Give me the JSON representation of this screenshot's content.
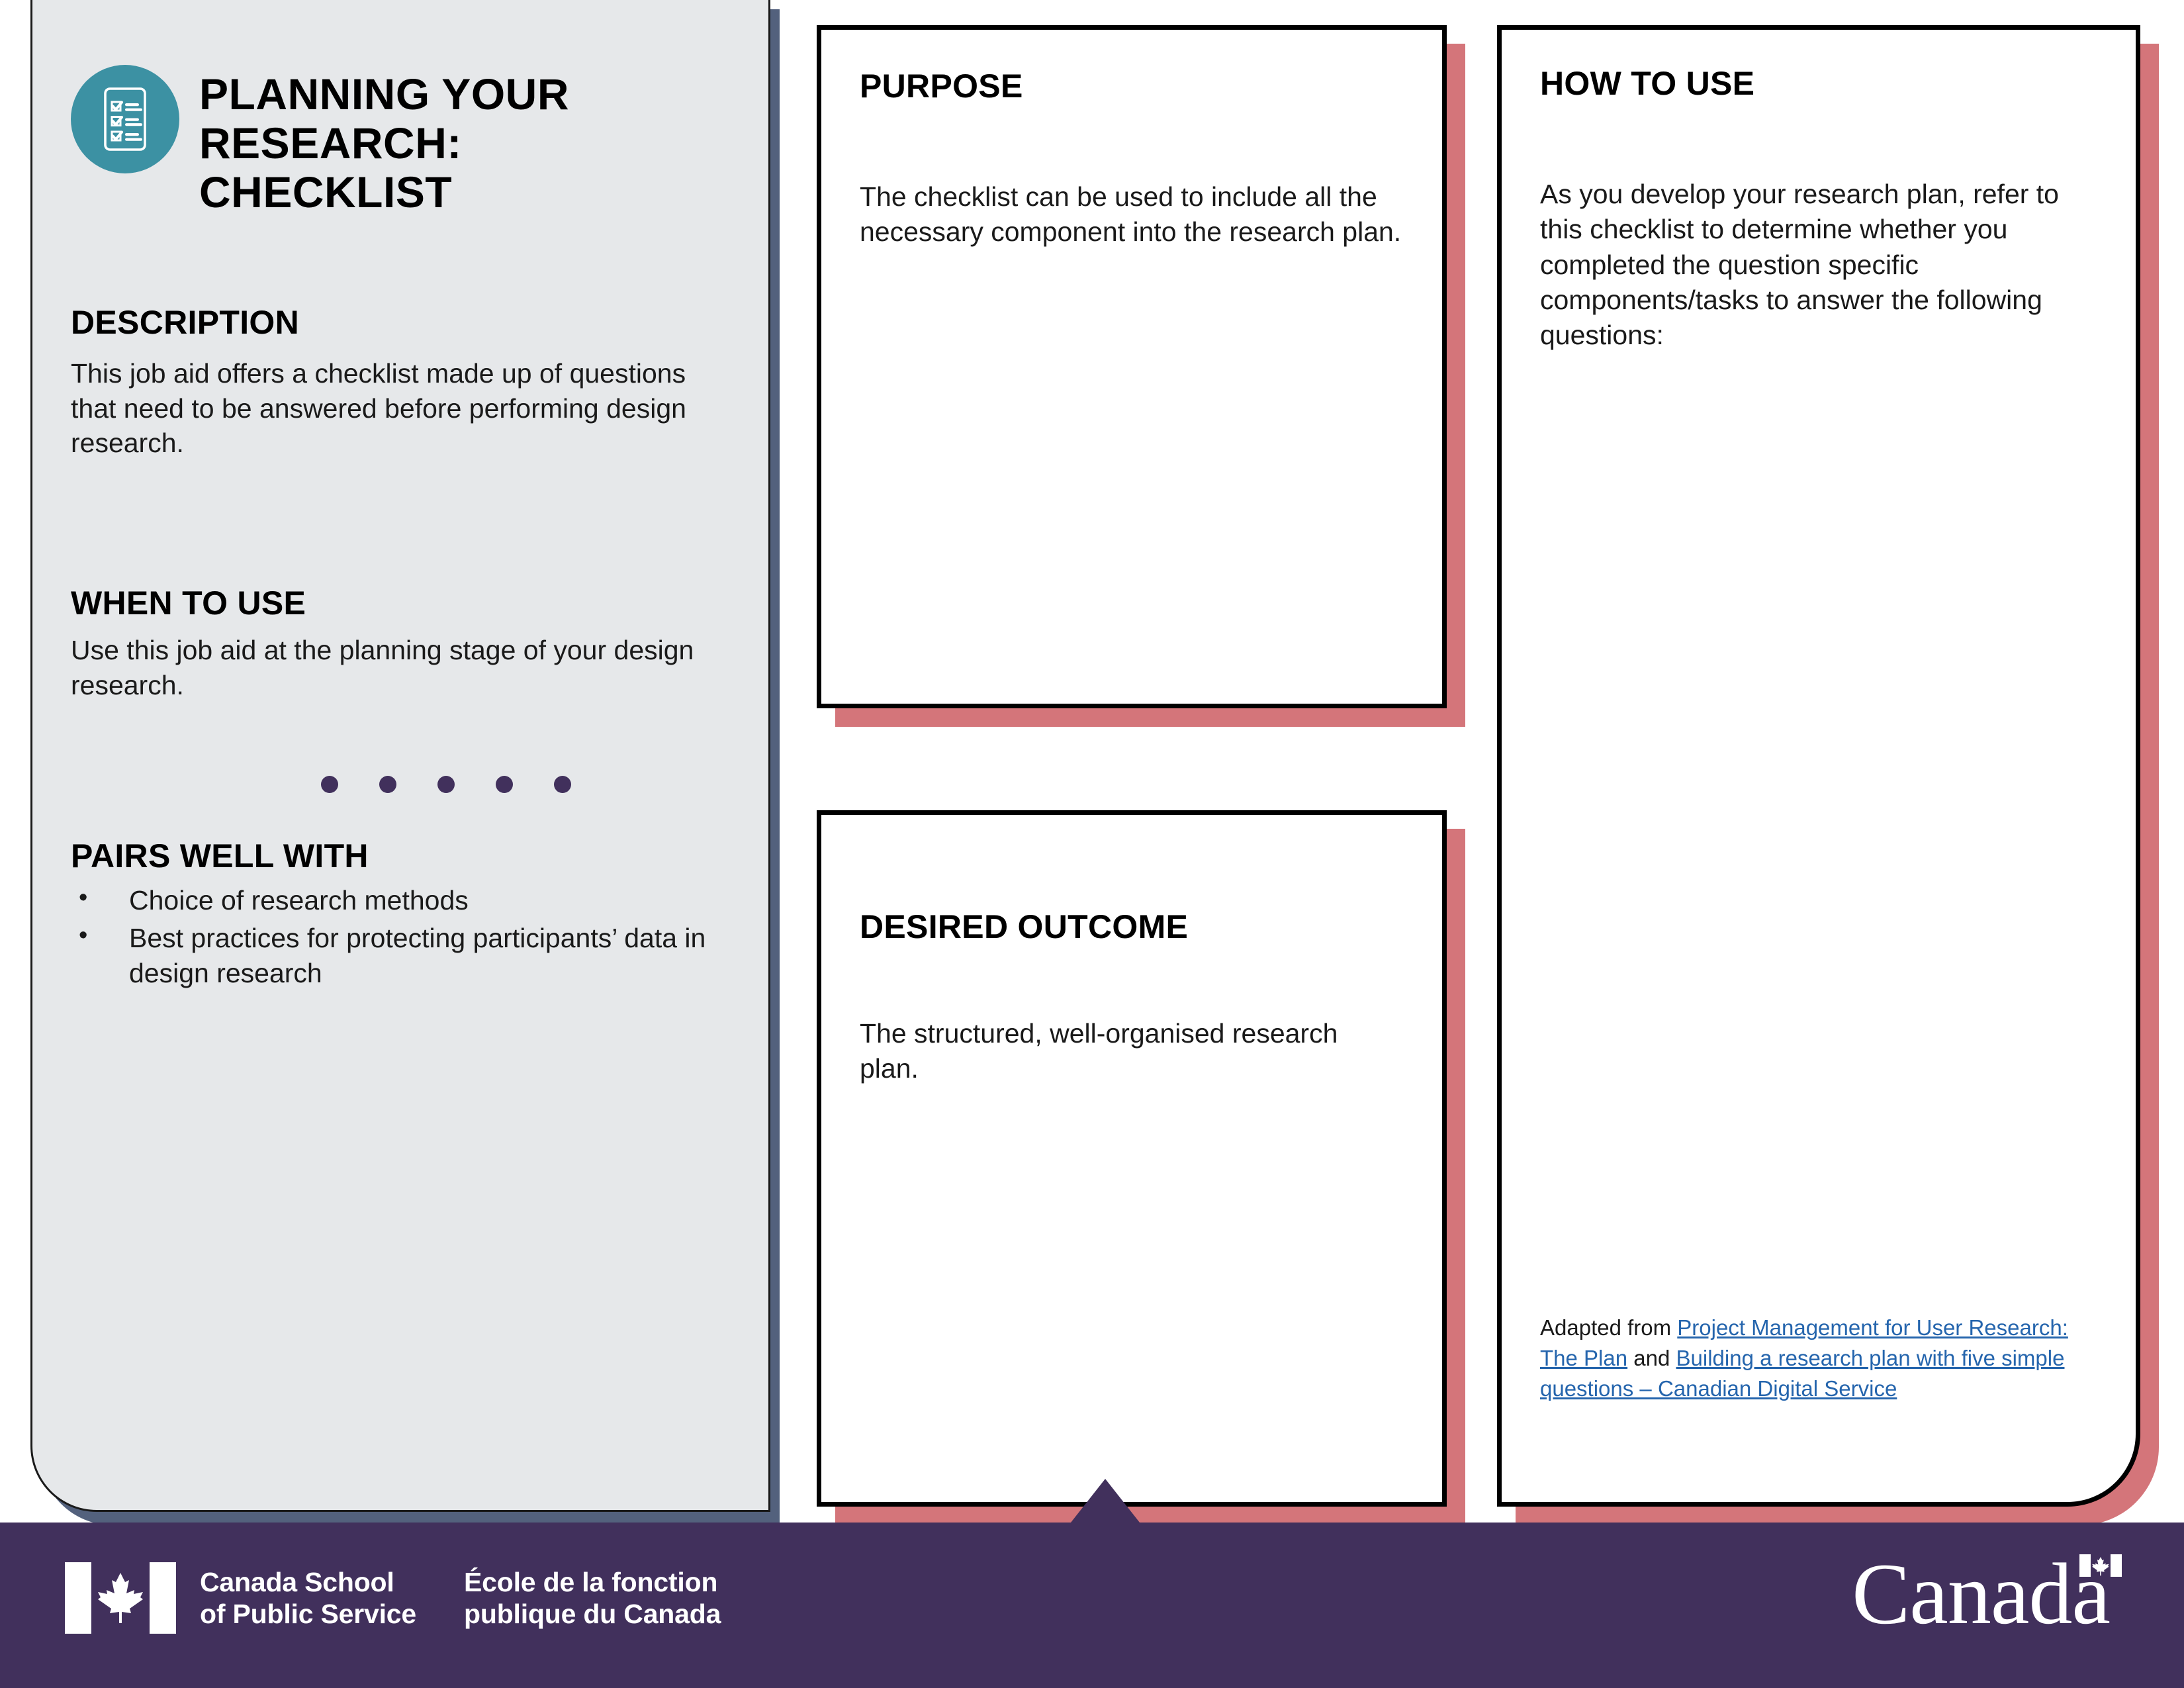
{
  "job_aid": {
    "icon_name": "checklist-clipboard-icon",
    "title": "PLANNING YOUR RESEARCH: CHECKLIST",
    "description": {
      "heading": "DESCRIPTION",
      "body": "This job aid offers a checklist made up of questions that need to be answered before performing design research."
    },
    "when_to_use": {
      "heading": "WHEN TO USE",
      "body": " Use this job aid at the planning stage of your design research."
    },
    "divider": {
      "dot_count": 5,
      "dot_color": "#41305c"
    },
    "pairs_well_with": {
      "heading": "PAIRS WELL WITH",
      "items": [
        "Choice of  research methods",
        "Best practices for protecting participants’ data in design research"
      ]
    }
  },
  "cards": {
    "purpose": {
      "title": "PURPOSE",
      "body": "The checklist can be used to include all the necessary component into the research plan."
    },
    "desired_outcome": {
      "title": "DESIRED OUTCOME",
      "body": "The structured, well-organised research plan."
    },
    "how_to_use": {
      "title": "HOW TO USE",
      "body": "As you develop your research plan, refer to this checklist to determine whether you completed the question specific components/tasks to answer the following questions:",
      "attribution": {
        "prefix": "Adapted from ",
        "link1": "Project Management for User Research: The Plan",
        "conjunction": " and ",
        "link2": "Building a research plan with five simple questions – Canadian Digital Service"
      }
    }
  },
  "footer": {
    "signature_en": "Canada School\nof Public Service",
    "signature_en_line1": "Canada School",
    "signature_en_line2": "of Public Service",
    "signature_fr_line1": "École de la fonction",
    "signature_fr_line2": "publique du Canada",
    "wordmark": "Canada",
    "flag_icon_name": "canada-flag-icon"
  },
  "colors": {
    "sidebar_bg": "#e6e8ea",
    "sidebar_shadow": "#53617d",
    "icon_teal": "#3c91a3",
    "card_shadow_pink": "#d4757a",
    "footer_purple": "#41305c",
    "link_blue": "#2565ad",
    "card_border": "#000000"
  }
}
